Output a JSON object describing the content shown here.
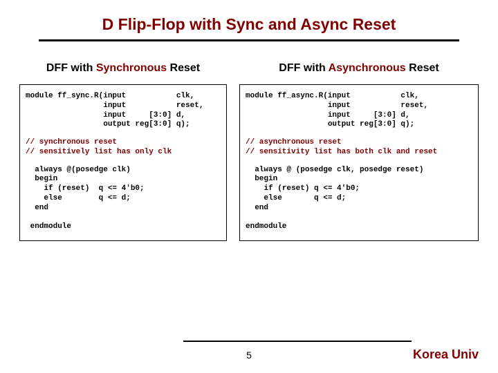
{
  "title": "D Flip-Flop with Sync and Async Reset",
  "left": {
    "heading_prefix": "DFF with ",
    "heading_em": "Synchronous",
    "heading_suffix": " Reset",
    "code_decl": "module ff_sync.R(input           clk,\n                 input           reset,\n                 input     [3:0] d,\n                 output reg[3:0] q);",
    "code_comment": "// synchronous reset\n// sensitively list has only clk",
    "code_body": "  always @(posedge clk)\n  begin\n    if (reset)  q <= 4'b0;\n    else        q <= d;\n  end\n\n endmodule"
  },
  "right": {
    "heading_prefix": "DFF with ",
    "heading_em": "Asynchronous",
    "heading_suffix": " Reset",
    "code_decl": "module ff_async.R(input           clk,\n                  input           reset,\n                  input     [3:0] d,\n                  output reg[3:0] q);",
    "code_comment": "// asynchronous reset\n// sensitivity list has both clk and reset",
    "code_body": "  always @ (posedge clk, posedge reset)\n  begin\n    if (reset) q <= 4'b0;\n    else       q <= d;\n  end\n\nendmodule"
  },
  "page": "5",
  "logo": "Korea Univ"
}
